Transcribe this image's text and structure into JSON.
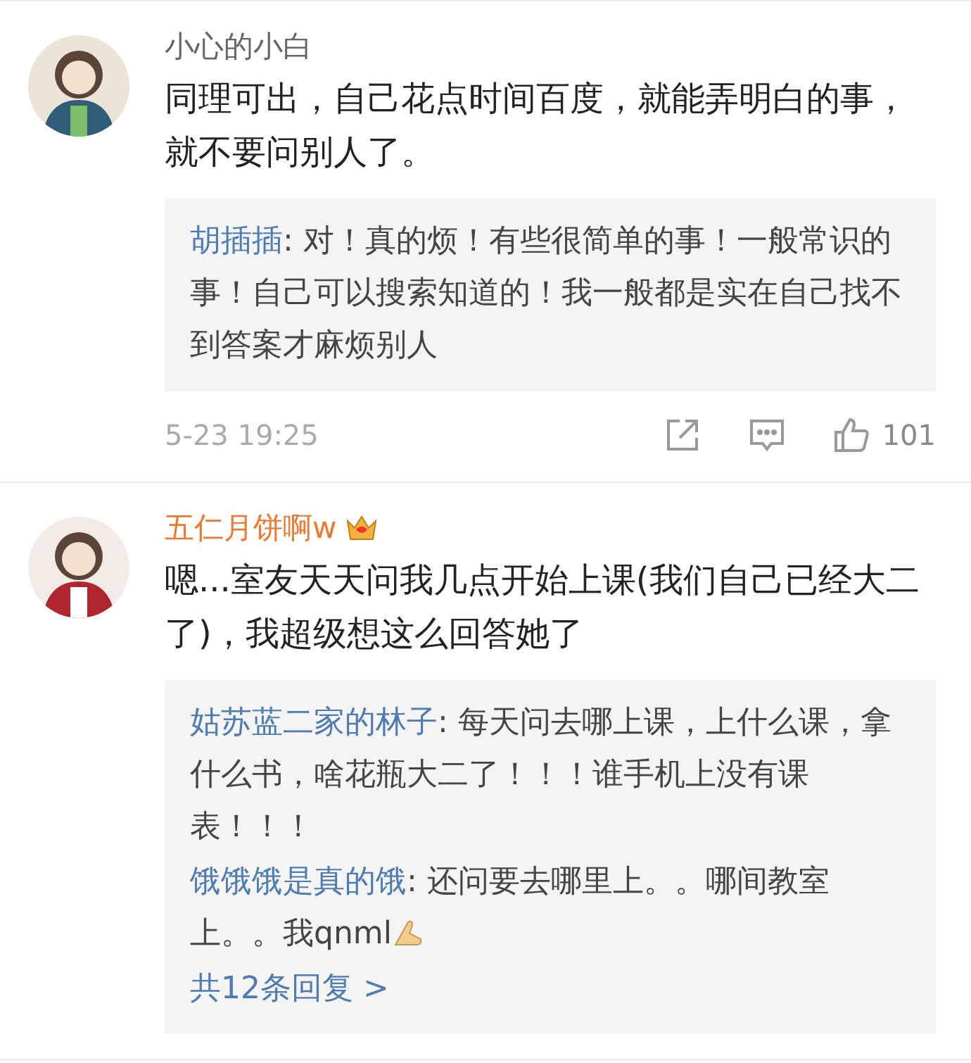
{
  "comments": [
    {
      "user": {
        "name": "小心的小白",
        "vip": false
      },
      "text": "同理可出，自己花点时间百度，就能弄明白的事，就不要问别人了。",
      "replies": [
        {
          "user": "胡插插",
          "text": ": 对！真的烦！有些很简单的事！一般常识的事！自己可以搜索知道的！我一般都是实在自己找不到答案才麻烦别人",
          "emoji": false
        }
      ],
      "footer": {
        "time": "5-23 19:25",
        "likes": "101"
      }
    },
    {
      "user": {
        "name": "五仁月饼啊w",
        "vip": true
      },
      "text": "嗯...室友天天问我几点开始上课(我们自己已经大二了)，我超级想这么回答她了",
      "replies": [
        {
          "user": "姑苏蓝二家的林子",
          "text": ": 每天问去哪上课，上什么课，拿什么书，啥花瓶大二了！！！谁手机上没有课表！！！",
          "emoji": false
        },
        {
          "user": "饿饿饿是真的饿",
          "text": ": 还问要去哪里上。。哪间教室上。。我qnml",
          "emoji": true
        }
      ],
      "more": "共12条回复 >"
    }
  ]
}
